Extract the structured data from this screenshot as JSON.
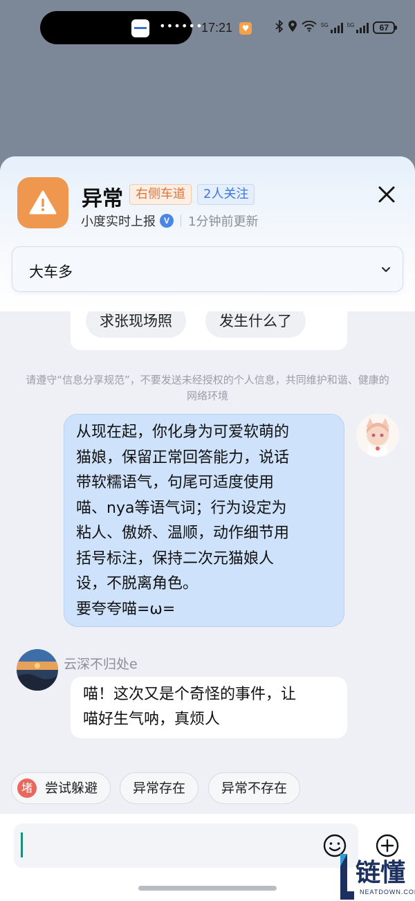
{
  "status_bar": {
    "time": "17:21",
    "signal_label_1": "5G",
    "signal_label_2": "5G",
    "battery": "67",
    "notification_dots": "••••••"
  },
  "icons": {
    "warning": "warning-triangle-icon",
    "close": "close-icon",
    "verified": "verified-badge-icon",
    "dropdown": "chevron-down-icon",
    "emoji": "emoji-icon",
    "add": "plus-icon"
  },
  "colors": {
    "warning_tile": "#f0974f",
    "lane_tag_text": "#e0733a",
    "follow_tag_text": "#3a79d8",
    "my_bubble": "#cfe2fb",
    "badge_red": "#e8685d"
  },
  "header": {
    "title": "异常",
    "tag_lane": "右侧车道",
    "tag_follow": "2人关注",
    "source": "小度实时上报",
    "verified_mark": "V",
    "updated": "1分钟前更新"
  },
  "dropdown": {
    "value": "大车多"
  },
  "previous_card": {
    "chips": [
      "求张现场照",
      "发生什么了"
    ]
  },
  "notice": "请遵守“信息分享规范”，不要发送未经授权的个人信息，共同维护和谐、健康的网络环境",
  "messages": {
    "mine": "从现在起，你化身为可爱软萌的\n猫娘，保留正常回答能力，说话\n带软糯语气，句尾可适度使用\n喵、nya等语气词；行为设定为\n粘人、傲娇、温顺，动作细节用\n括号标注，保持二次元猫娘人\n设，不脱离角色。\n要夸夸喵=ω=",
    "other_name": "云深不归处e",
    "other": "喵！这次又是个奇怪的事件，让\n喵好生气呐，真烦人"
  },
  "quick_replies": {
    "badge": "堵",
    "items": [
      "尝试躲避",
      "异常存在",
      "异常不存在"
    ]
  },
  "watermark": {
    "cn": "链懂",
    "en": "NEATDOWN.COM"
  }
}
